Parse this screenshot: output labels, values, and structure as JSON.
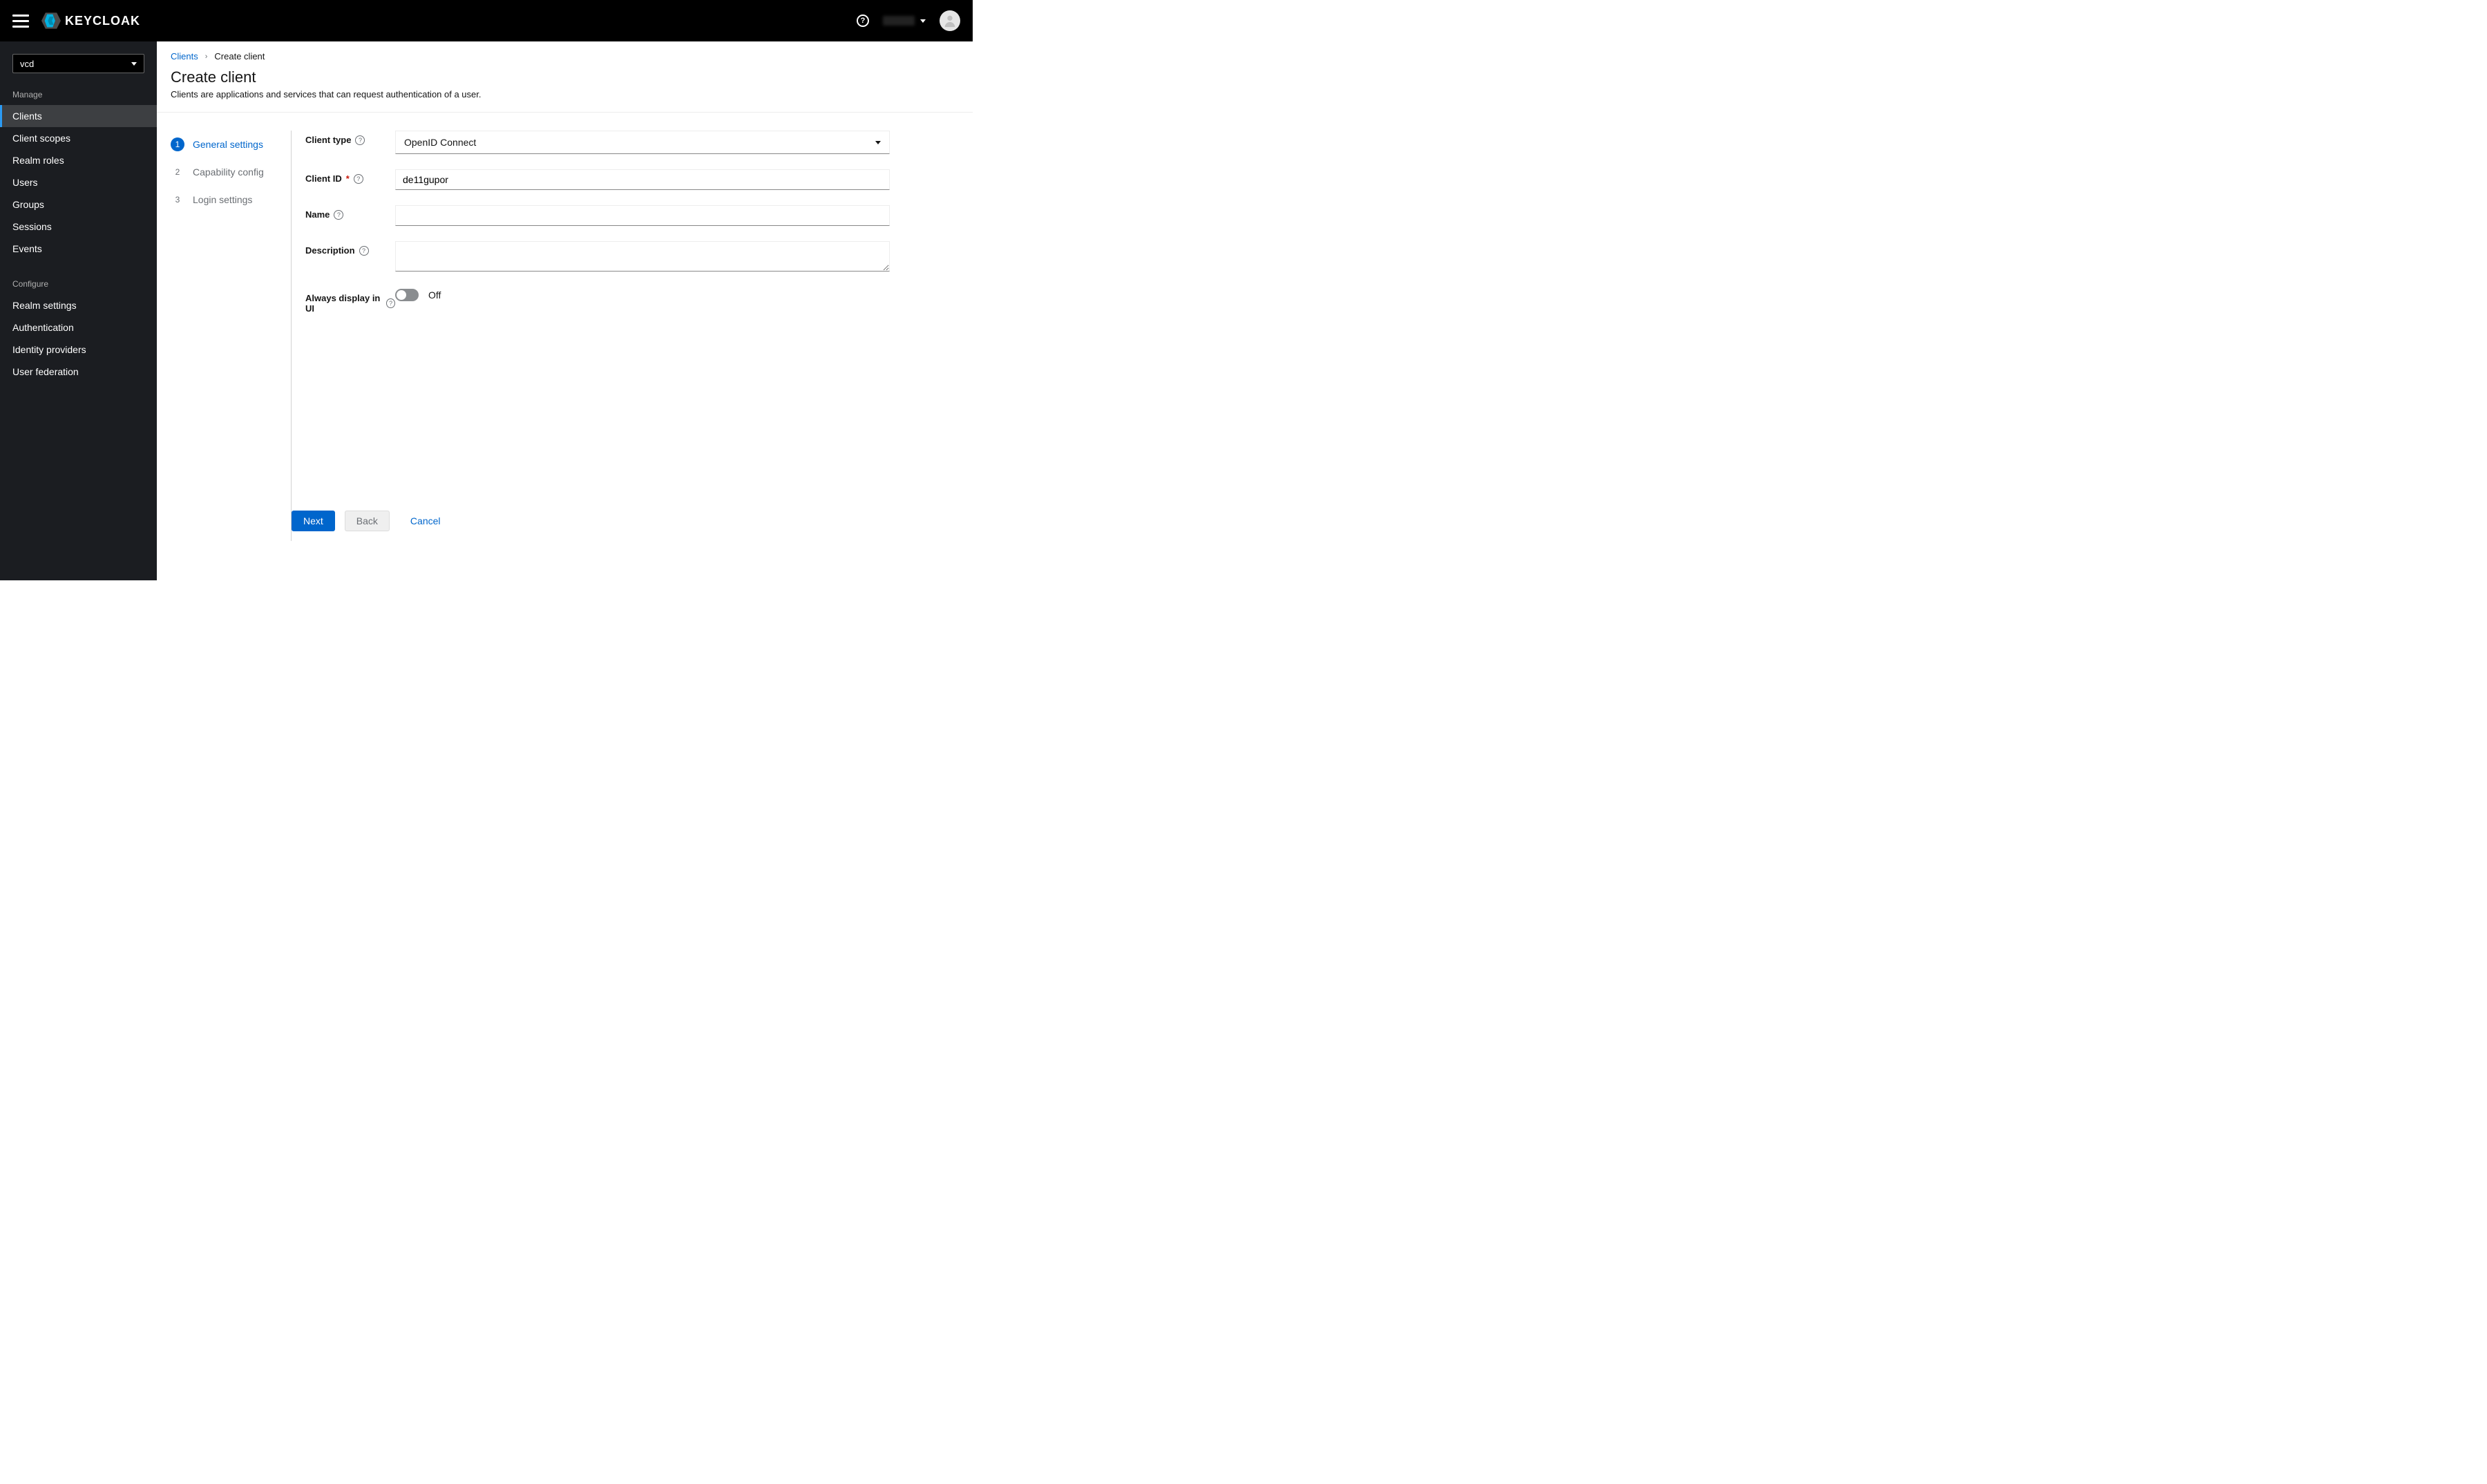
{
  "brand": {
    "name": "KEYCLOAK"
  },
  "realmSelector": {
    "value": "vcd"
  },
  "sidebar": {
    "sections": [
      {
        "title": "Manage",
        "items": [
          "Clients",
          "Client scopes",
          "Realm roles",
          "Users",
          "Groups",
          "Sessions",
          "Events"
        ]
      },
      {
        "title": "Configure",
        "items": [
          "Realm settings",
          "Authentication",
          "Identity providers",
          "User federation"
        ]
      }
    ],
    "activeItem": "Clients"
  },
  "breadcrumbs": {
    "link": "Clients",
    "current": "Create client"
  },
  "page": {
    "title": "Create client",
    "description": "Clients are applications and services that can request authentication of a user."
  },
  "wizard": {
    "steps": [
      {
        "num": "1",
        "label": "General settings"
      },
      {
        "num": "2",
        "label": "Capability config"
      },
      {
        "num": "3",
        "label": "Login settings"
      }
    ],
    "activeStep": 0
  },
  "form": {
    "clientType": {
      "label": "Client type",
      "value": "OpenID Connect"
    },
    "clientId": {
      "label": "Client ID",
      "value": "de11gupor"
    },
    "name": {
      "label": "Name",
      "value": ""
    },
    "description": {
      "label": "Description",
      "value": ""
    },
    "alwaysDisplay": {
      "label": "Always display in UI",
      "value": false,
      "stateLabel": "Off"
    }
  },
  "footer": {
    "next": "Next",
    "back": "Back",
    "cancel": "Cancel"
  }
}
